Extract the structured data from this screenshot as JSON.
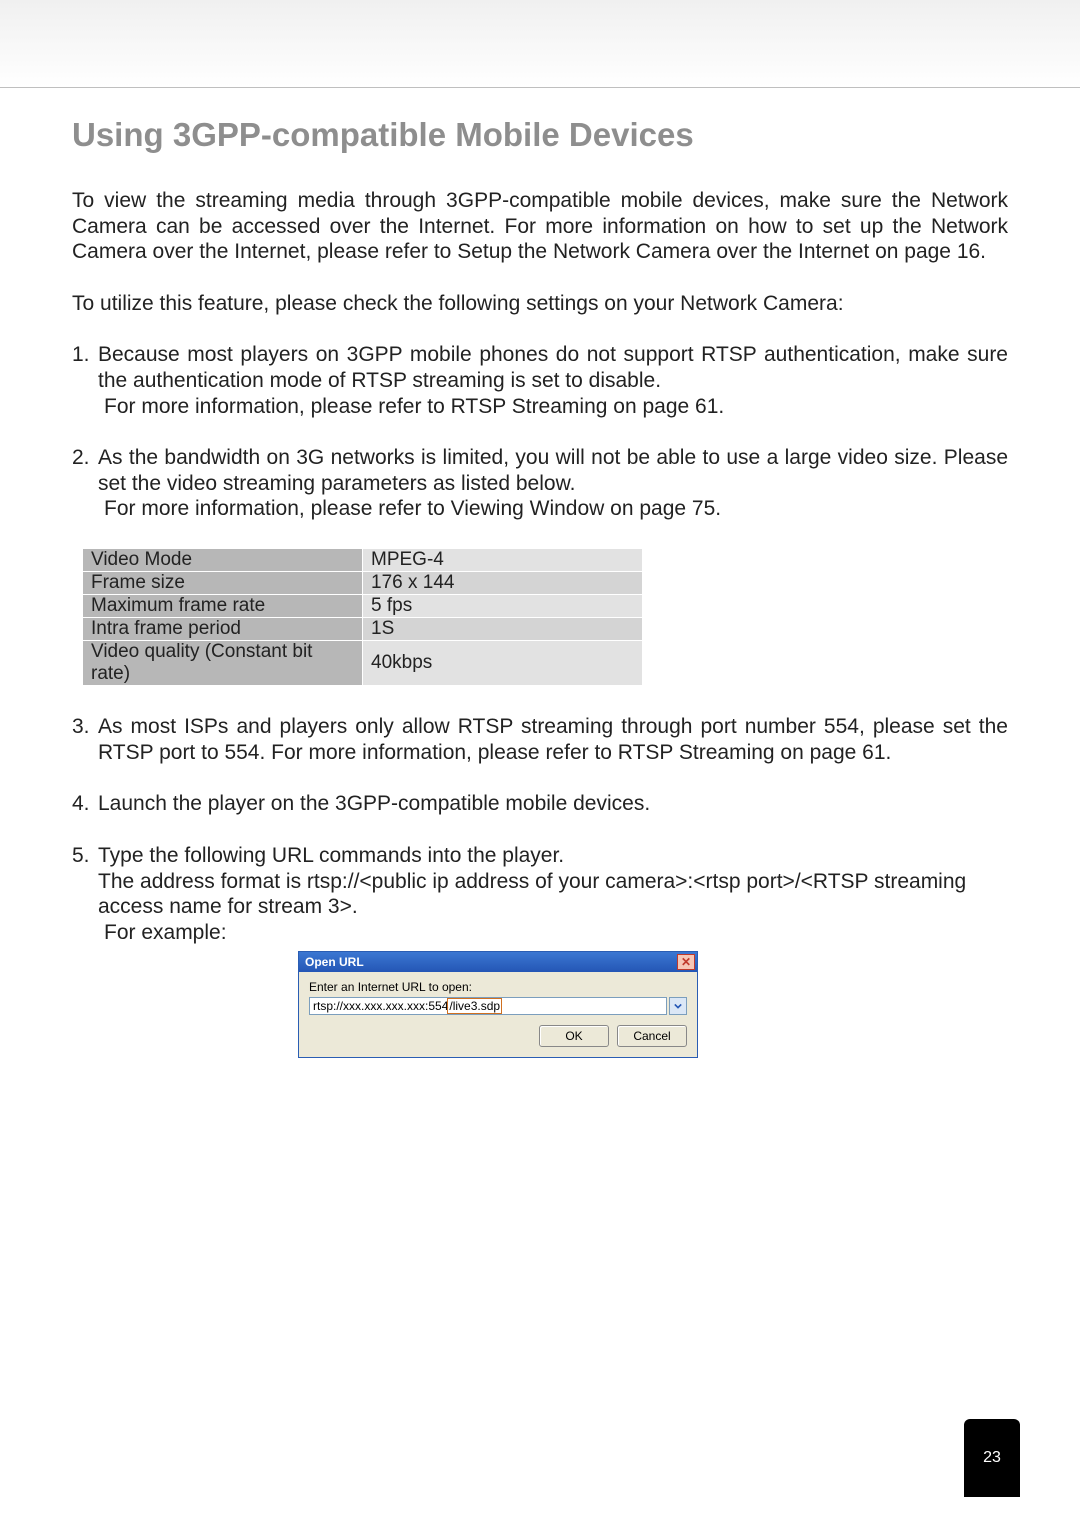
{
  "title": "Using 3GPP-compatible Mobile Devices",
  "para1": "To view the streaming media through 3GPP-compatible mobile devices, make sure the Network Camera can be accessed over the Internet. For more information on how to set up the Network Camera over the Internet, please refer to Setup the Network Camera over the Internet on page 16.",
  "para2": "To utilize this feature, please check the following settings on your Network Camera:",
  "items": [
    {
      "num": "1.",
      "text": "Because most players on 3GPP mobile phones do not support RTSP authentication, make sure the authentication mode of RTSP streaming is set to disable.",
      "sub": [
        "For more information, please refer to RTSP Streaming on page 61."
      ]
    },
    {
      "num": "2.",
      "text": "As the bandwidth on 3G networks is limited, you will not be able to use a large video size. Please set the video streaming parameters as listed below.",
      "sub": [
        "For more information, please refer to Viewing Window on page 75."
      ]
    }
  ],
  "setting_rows": [
    {
      "label": "Video Mode",
      "value": "MPEG-4"
    },
    {
      "label": "Frame size",
      "value": "176 x 144"
    },
    {
      "label": "Maximum frame rate",
      "value": "5 fps"
    },
    {
      "label": "Intra frame period",
      "value": "1S"
    },
    {
      "label": "Video quality (Constant bit rate)",
      "value": "40kbps"
    }
  ],
  "items2": [
    {
      "num": "3.",
      "text": "As most ISPs and players only allow RTSP streaming through port number 554, please set the RTSP port to 554. For more information, please refer to RTSP Streaming on page 61.",
      "sub": []
    },
    {
      "num": "4.",
      "text": "Launch the player on the 3GPP-compatible mobile devices.",
      "sub": []
    },
    {
      "num": "5.",
      "text": "Type the following URL commands into the player.",
      "sub": [
        "The address format is rtsp://<public ip address of your camera>:<rtsp port>/<RTSP streaming access name for stream 3>.",
        "For example:"
      ]
    }
  ],
  "dialog": {
    "title": "Open URL",
    "label": "Enter an Internet URL to open:",
    "input_prefix": "rtsp://xxx.xxx.xxx.xxx:554",
    "input_highlight": "/live3.sdp",
    "ok": "OK",
    "cancel": "Cancel"
  },
  "page_number": "23"
}
